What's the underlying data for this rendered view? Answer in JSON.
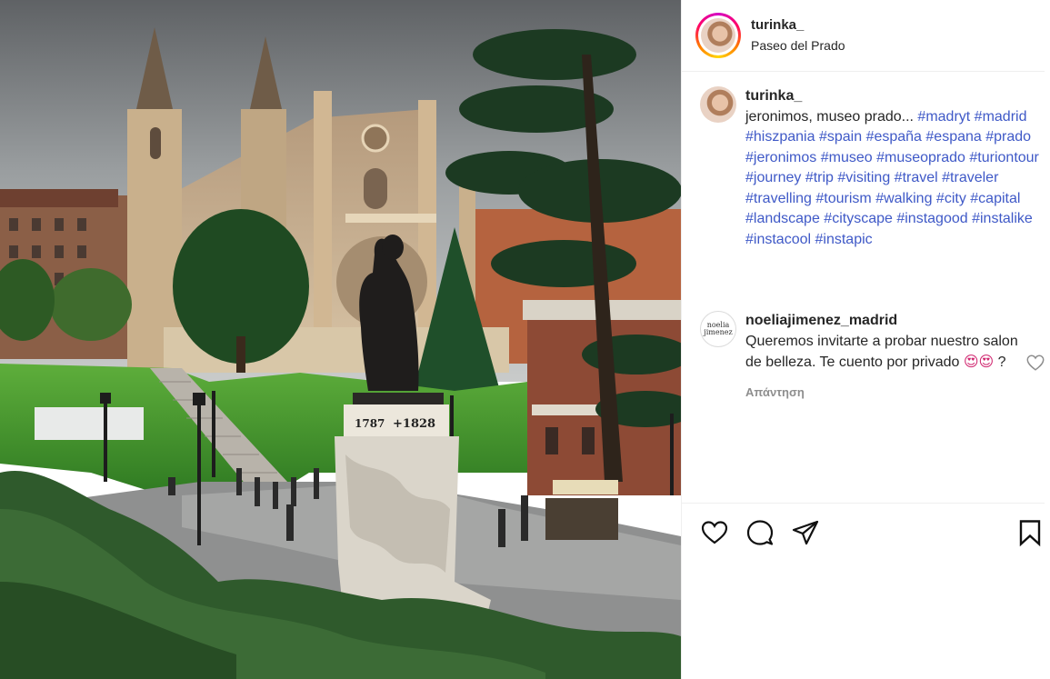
{
  "photo": {
    "statue_inscription_left": "1787",
    "statue_inscription_right": "+1828"
  },
  "header": {
    "username": "turinka_",
    "location": "Paseo del Prado"
  },
  "post": {
    "username": "turinka_",
    "caption_text": "jeronimos, museo prado... ",
    "hashtags": [
      "#madryt",
      "#madrid",
      "#hiszpania",
      "#spain",
      "#españa",
      "#espana",
      "#prado",
      "#jeronimos",
      "#museo",
      "#museoprado",
      "#turiontour",
      "#journey",
      "#trip",
      "#visiting",
      "#travel",
      "#traveler",
      "#travelling",
      "#tourism",
      "#walking",
      "#city",
      "#capital",
      "#landscape",
      "#cityscape",
      "#instagood",
      "#instalike",
      "#instacool",
      "#instapic"
    ]
  },
  "comment": {
    "avatar_text": "noelia jimenez",
    "username": "noeliajimenez_madrid",
    "text": "Queremos invitarte a probar nuestro salon de belleza. Te cuento por privado",
    "emoji": "😍😍",
    "suffix": " ?",
    "reply_label": "Απάντηση"
  },
  "icons": [
    "heart-icon",
    "comment-icon",
    "share-icon",
    "bookmark-icon"
  ]
}
